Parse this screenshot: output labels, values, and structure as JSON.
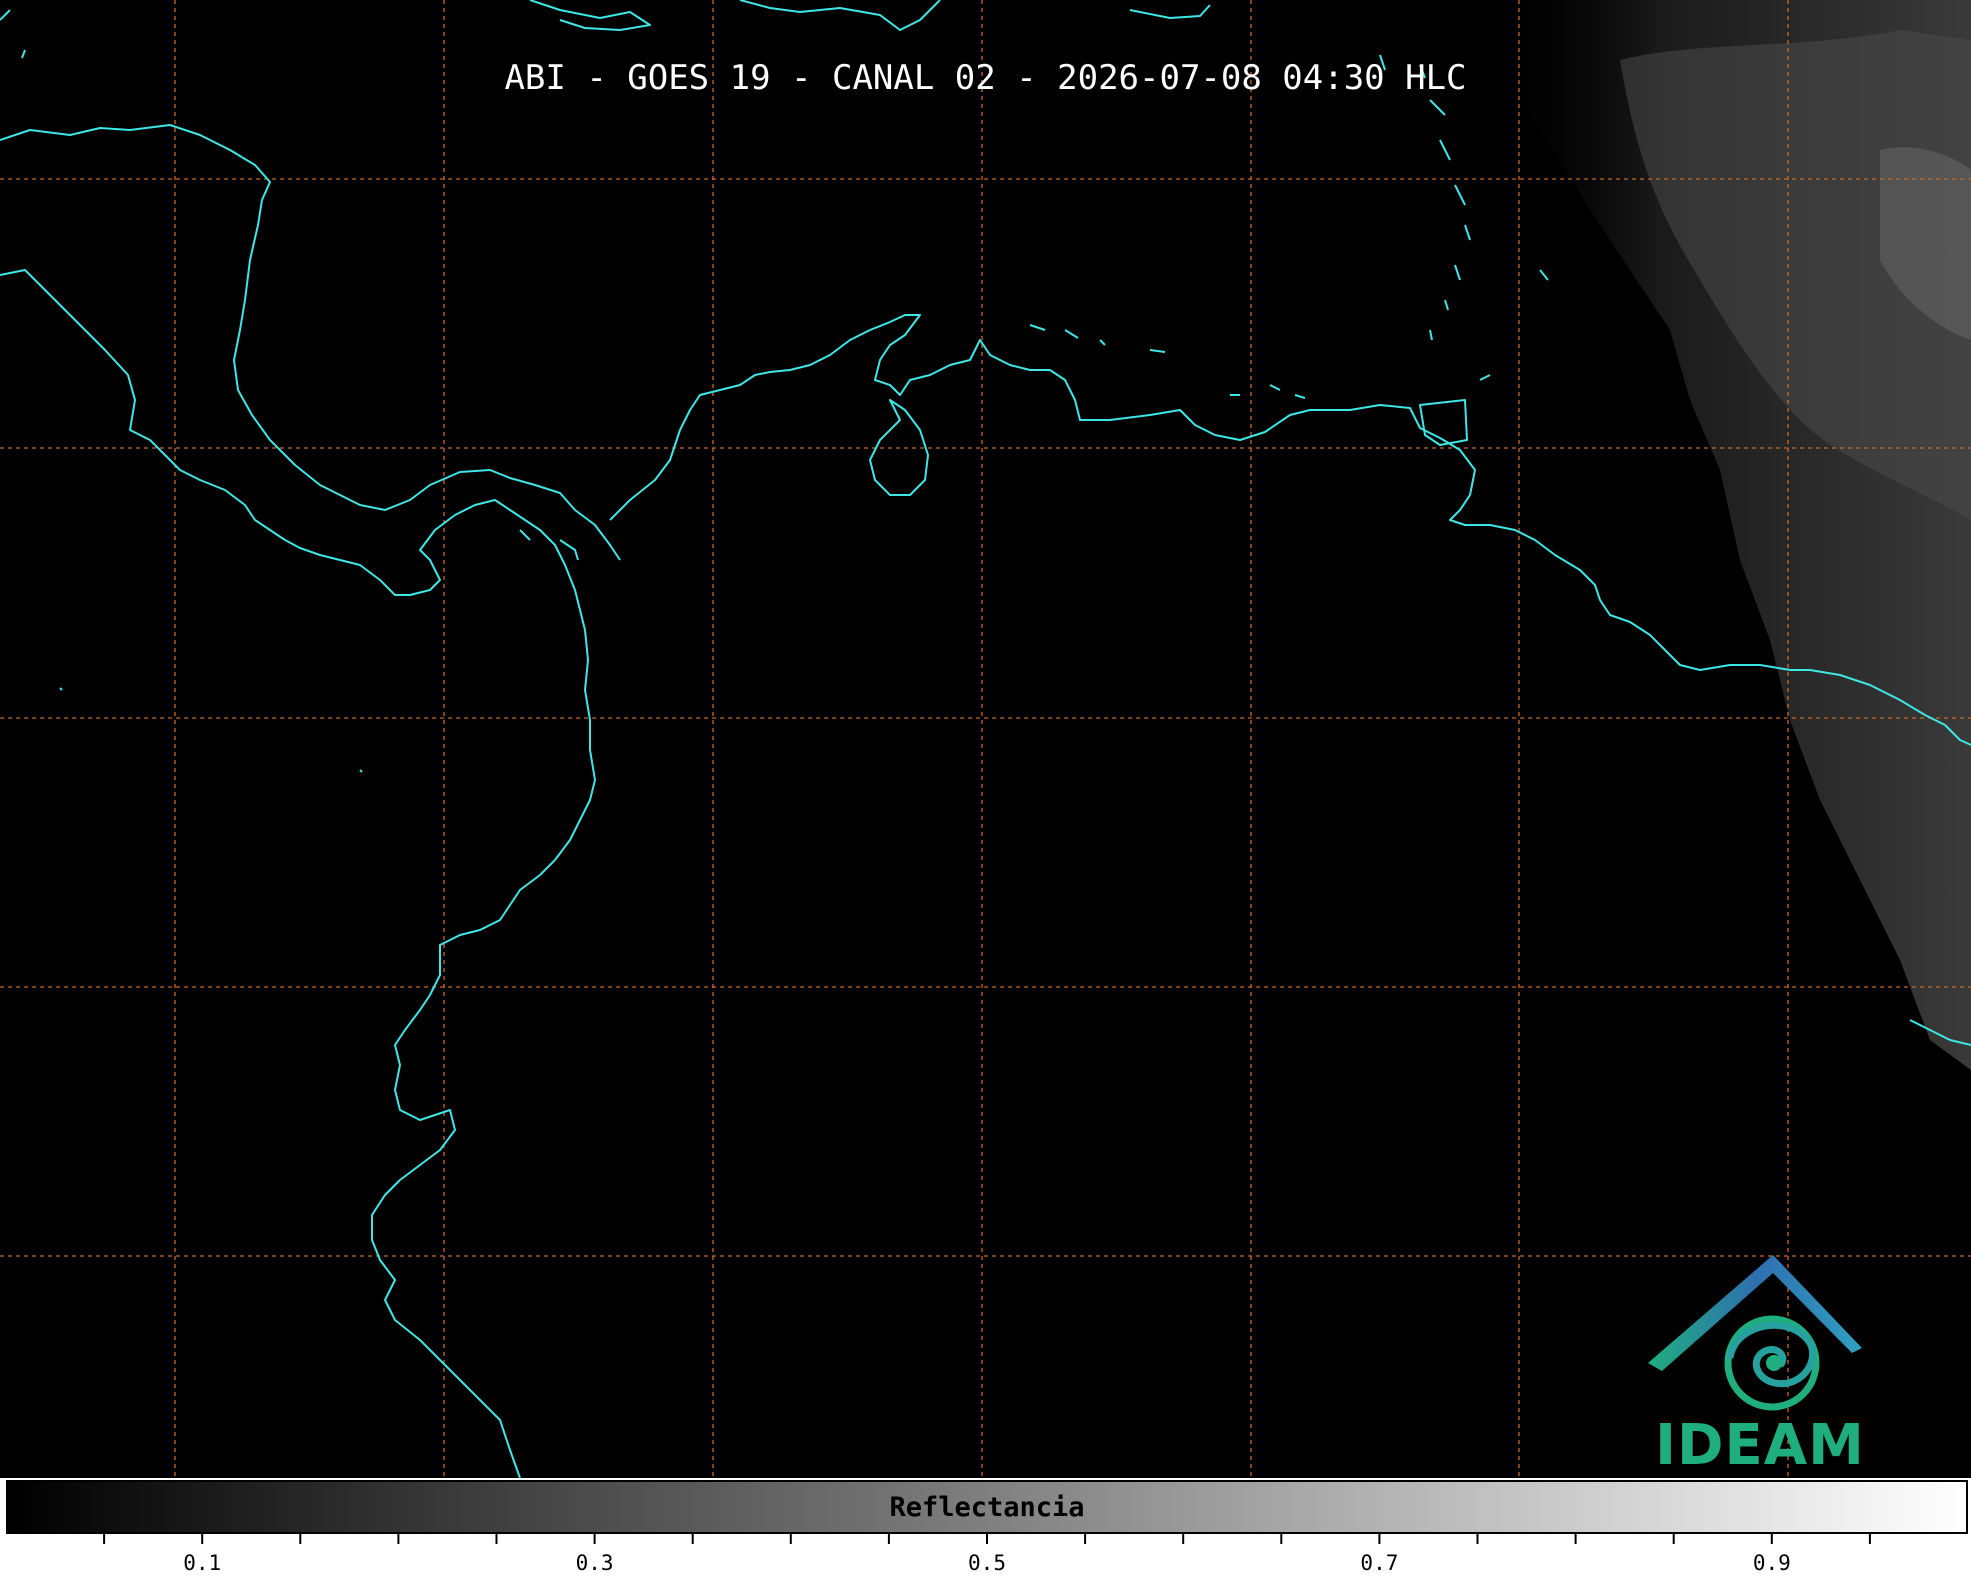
{
  "title": "ABI - GOES 19 - CANAL 02 - 2026-07-08 04:30 HLC",
  "logo": {
    "text": "IDEAM",
    "icon": "ideam-eye-house-logo",
    "color_primary": "#1fae7e",
    "color_secondary": "#2f6fb0"
  },
  "colorbar": {
    "label": "Reflectancia",
    "min": 0.0,
    "max": 1.0,
    "tick_labels": [
      "0.1",
      "0.3",
      "0.5",
      "0.7",
      "0.9"
    ],
    "tick_values": [
      0.1,
      0.3,
      0.5,
      0.7,
      0.9
    ],
    "minor_tick_step": 0.05,
    "colormap": "grayscale"
  },
  "map_style": {
    "background": "#000000",
    "coastline_color": "#3fe6e6",
    "gridline_color": "#c8682a",
    "gridline_style": "dashed"
  }
}
